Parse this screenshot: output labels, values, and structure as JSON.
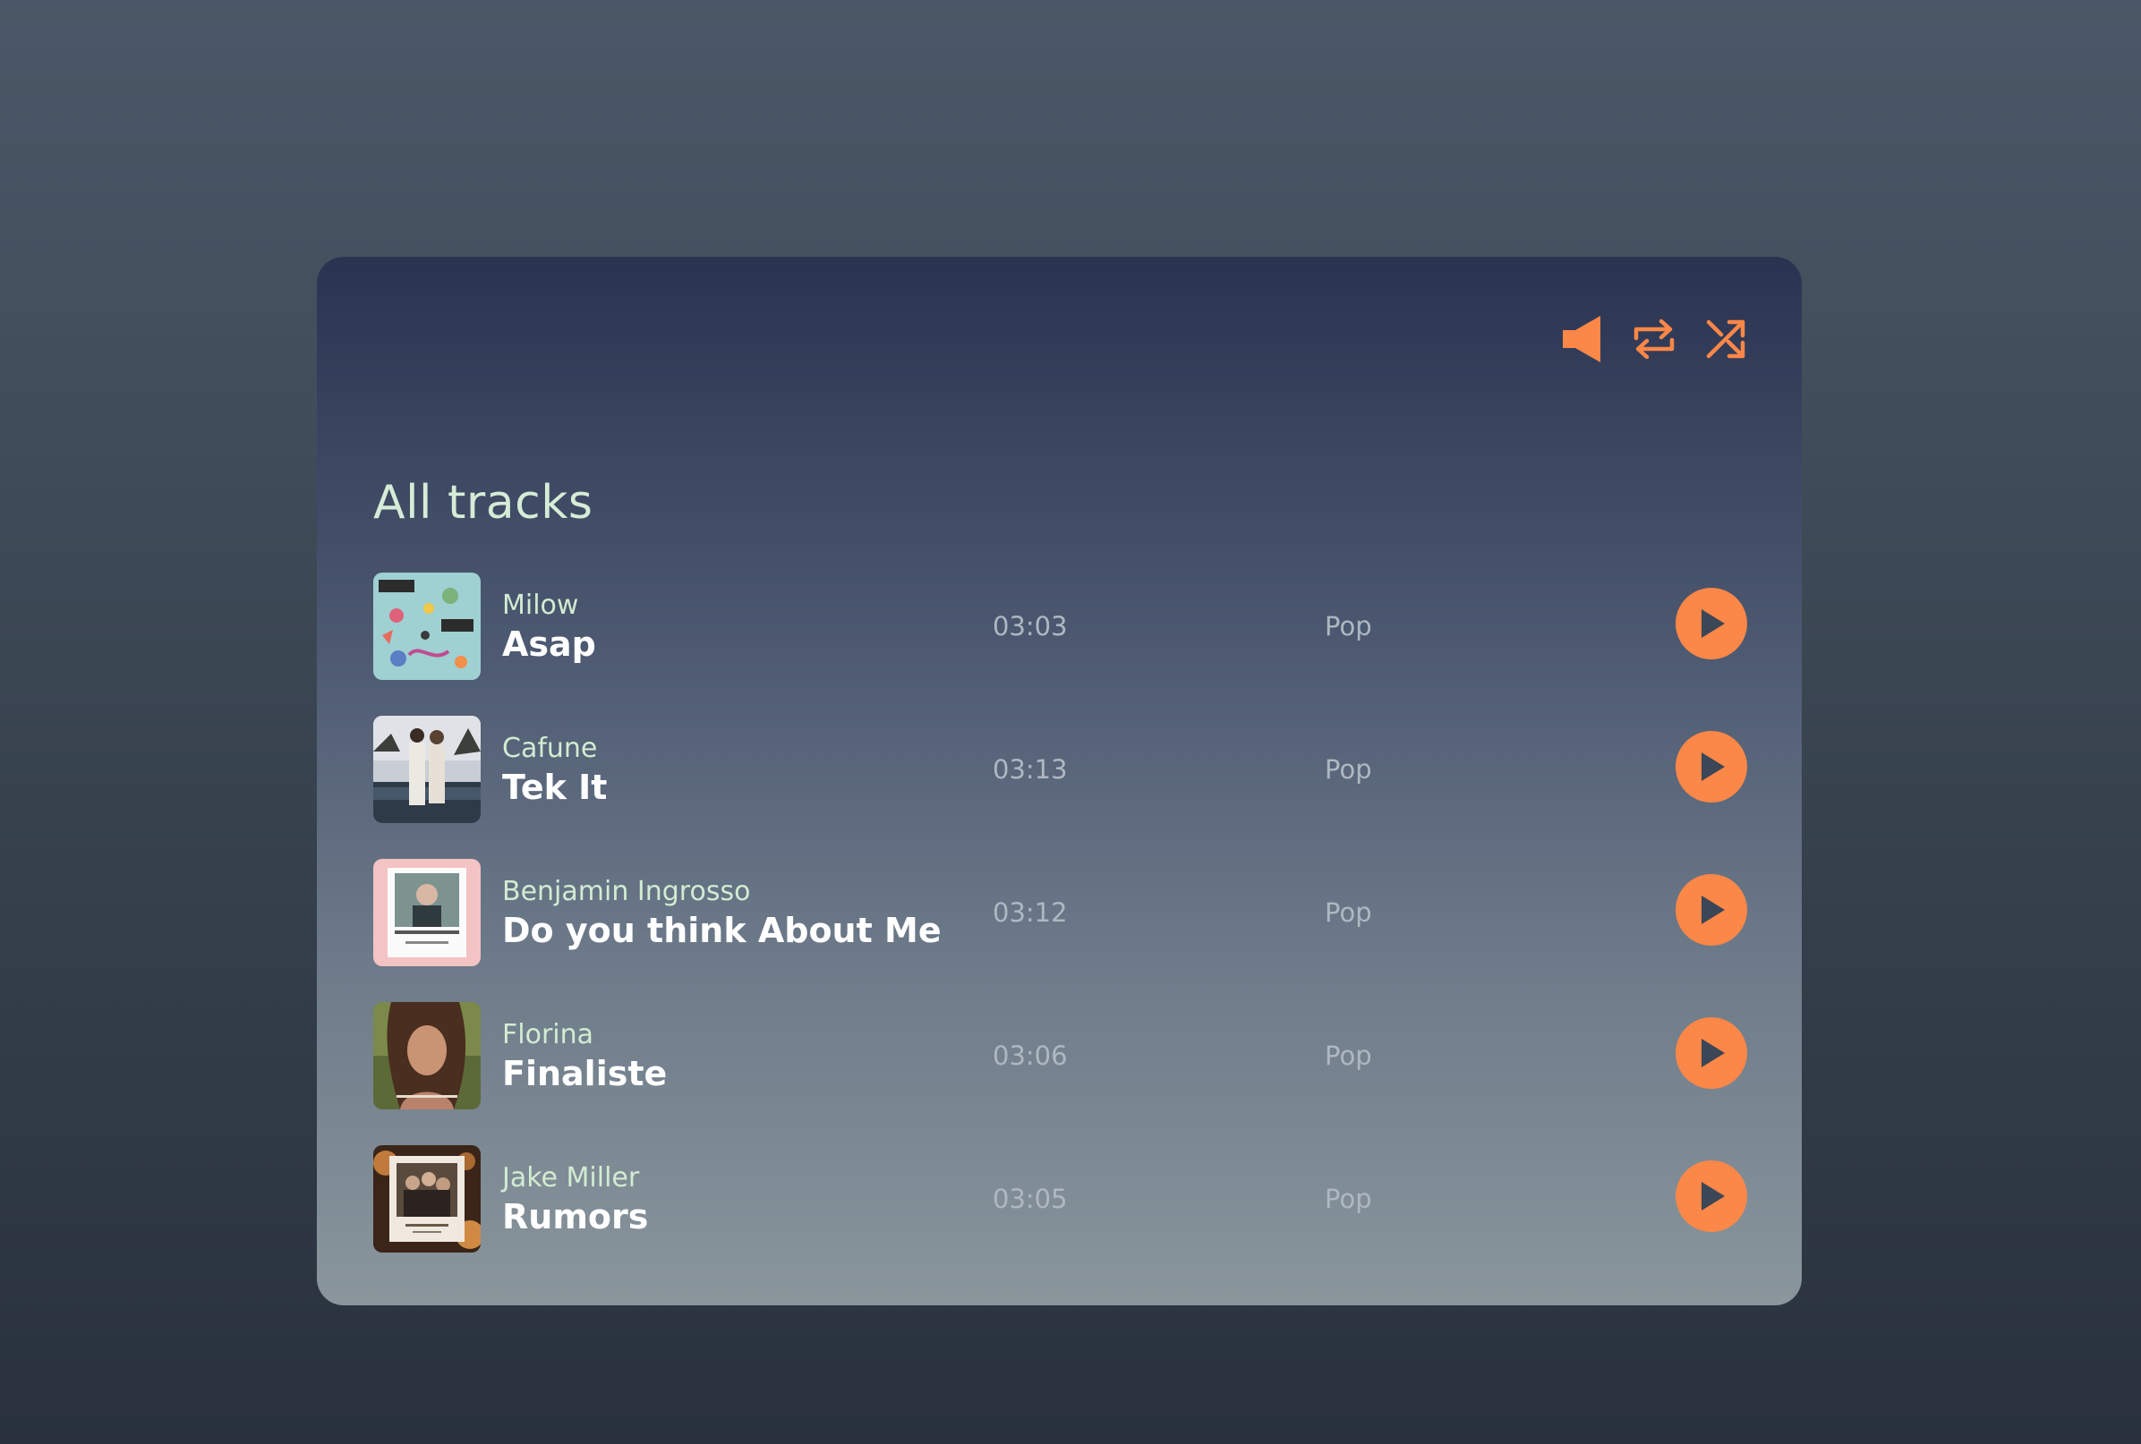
{
  "colors": {
    "accent": "#fb8748",
    "heading": "#d7ecd7",
    "title": "#ffffff",
    "meta": "#aeb8c2"
  },
  "controls": [
    {
      "icon": "volume-icon"
    },
    {
      "icon": "repeat-icon"
    },
    {
      "icon": "shuffle-icon"
    }
  ],
  "section_title": "All tracks",
  "tracks": [
    {
      "artist": "Milow",
      "title": "Asap",
      "duration": "03:03",
      "genre": "Pop"
    },
    {
      "artist": "Cafune",
      "title": "Tek It",
      "duration": "03:13",
      "genre": "Pop"
    },
    {
      "artist": "Benjamin Ingrosso",
      "title": "Do you think About Me",
      "duration": "03:12",
      "genre": "Pop"
    },
    {
      "artist": "Florina",
      "title": "Finaliste",
      "duration": "03:06",
      "genre": "Pop"
    },
    {
      "artist": "Jake Miller",
      "title": "Rumors",
      "duration": "03:05",
      "genre": "Pop"
    }
  ]
}
